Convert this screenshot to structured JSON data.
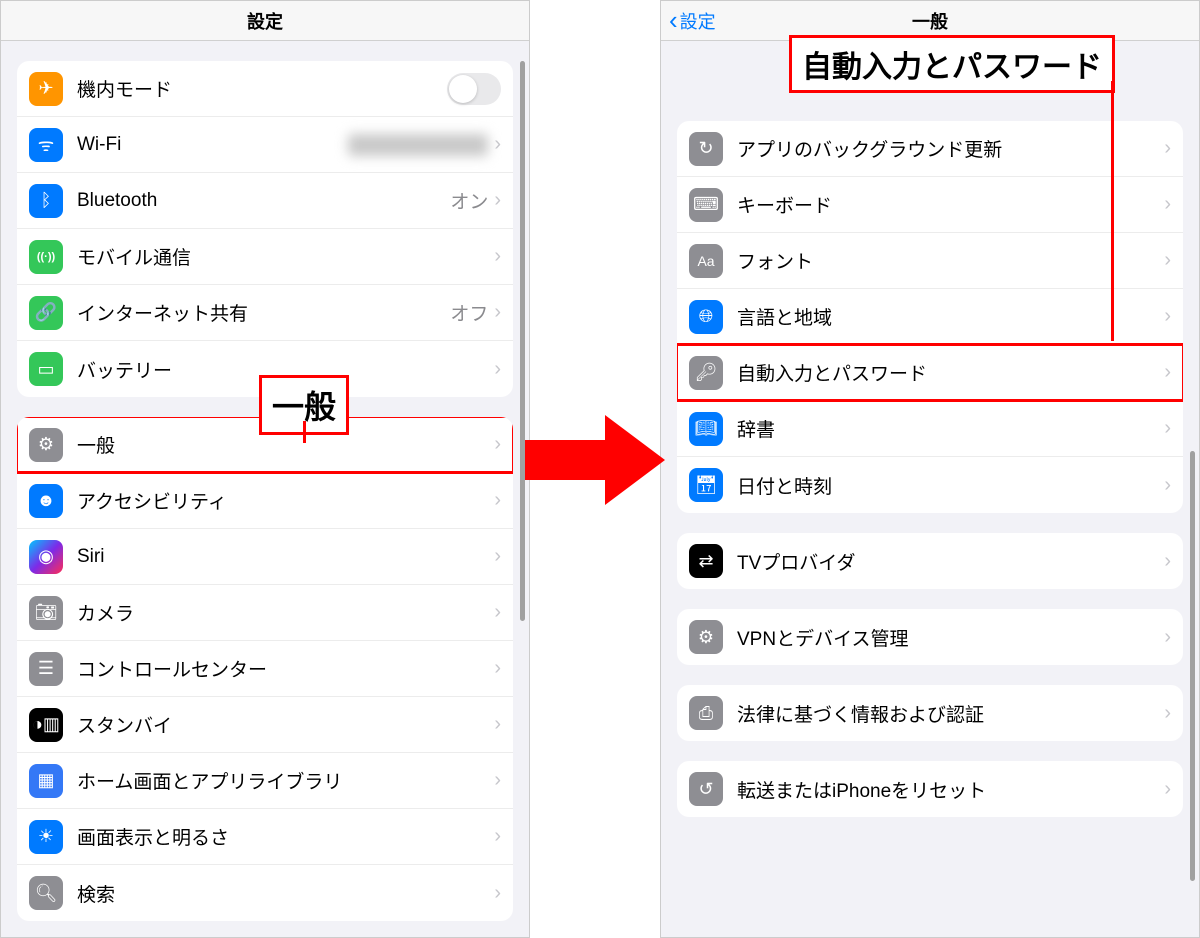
{
  "annotations": {
    "left_label": "一般",
    "right_label": "自動入力とパスワード"
  },
  "left": {
    "title": "設定",
    "items": [
      {
        "name": "airplane-mode",
        "label": "機内モード",
        "icon": "airplane-icon",
        "iconBg": "bg-orange",
        "trailing": "toggle-off"
      },
      {
        "name": "wifi",
        "label": "Wi-Fi",
        "icon": "wifi-icon",
        "iconBg": "bg-blue",
        "trailing": "redacted-chevron"
      },
      {
        "name": "bluetooth",
        "label": "Bluetooth",
        "icon": "bluetooth-icon",
        "iconBg": "bg-blue",
        "value": "オン",
        "trailing": "value-chevron"
      },
      {
        "name": "cellular",
        "label": "モバイル通信",
        "icon": "antenna-icon",
        "iconBg": "bg-green",
        "trailing": "chevron"
      },
      {
        "name": "hotspot",
        "label": "インターネット共有",
        "icon": "link-icon",
        "iconBg": "bg-green",
        "value": "オフ",
        "trailing": "value-chevron"
      },
      {
        "name": "battery",
        "label": "バッテリー",
        "icon": "battery-icon",
        "iconBg": "bg-green",
        "trailing": "chevron"
      }
    ],
    "items2": [
      {
        "name": "general",
        "label": "一般",
        "icon": "gear-icon",
        "iconBg": "bg-gray",
        "trailing": "chevron",
        "highlight": true
      },
      {
        "name": "accessibility",
        "label": "アクセシビリティ",
        "icon": "accessibility-icon",
        "iconBg": "bg-blue",
        "trailing": "chevron"
      },
      {
        "name": "siri",
        "label": "Siri",
        "icon": "siri-icon",
        "iconBg": "bg-siri",
        "trailing": "chevron"
      },
      {
        "name": "camera",
        "label": "カメラ",
        "icon": "camera-icon",
        "iconBg": "bg-gray",
        "trailing": "chevron"
      },
      {
        "name": "control-center",
        "label": "コントロールセンター",
        "icon": "sliders-icon",
        "iconBg": "bg-gray",
        "trailing": "chevron"
      },
      {
        "name": "standby",
        "label": "スタンバイ",
        "icon": "standby-icon",
        "iconBg": "bg-black",
        "trailing": "chevron"
      },
      {
        "name": "home-screen",
        "label": "ホーム画面とアプリライブラリ",
        "icon": "apps-icon",
        "iconBg": "bg-blue2",
        "trailing": "chevron"
      },
      {
        "name": "display",
        "label": "画面表示と明るさ",
        "icon": "brightness-icon",
        "iconBg": "bg-blue",
        "trailing": "chevron"
      },
      {
        "name": "search",
        "label": "検索",
        "icon": "search-icon",
        "iconBg": "bg-gray",
        "trailing": "chevron"
      }
    ]
  },
  "right": {
    "back_label": "設定",
    "title": "一般",
    "groups": [
      [
        {
          "name": "bg-refresh",
          "label": "アプリのバックグラウンド更新",
          "icon": "refresh-icon",
          "iconBg": "bg-gray"
        },
        {
          "name": "keyboard",
          "label": "キーボード",
          "icon": "keyboard-icon",
          "iconBg": "bg-gray"
        },
        {
          "name": "fonts",
          "label": "フォント",
          "icon": "font-icon",
          "iconBg": "bg-gray"
        },
        {
          "name": "language",
          "label": "言語と地域",
          "icon": "globe-icon",
          "iconBg": "bg-blue"
        },
        {
          "name": "autofill",
          "label": "自動入力とパスワード",
          "icon": "key-icon",
          "iconBg": "bg-gray",
          "highlight": true
        },
        {
          "name": "dictionary",
          "label": "辞書",
          "icon": "book-icon",
          "iconBg": "bg-blue"
        },
        {
          "name": "datetime",
          "label": "日付と時刻",
          "icon": "calendar-icon",
          "iconBg": "bg-blue"
        }
      ],
      [
        {
          "name": "tv-provider",
          "label": "TVプロバイダ",
          "icon": "tv-icon",
          "iconBg": "bg-black"
        }
      ],
      [
        {
          "name": "vpn",
          "label": "VPNとデバイス管理",
          "icon": "vpn-icon",
          "iconBg": "bg-gray"
        }
      ],
      [
        {
          "name": "legal",
          "label": "法律に基づく情報および認証",
          "icon": "cert-icon",
          "iconBg": "bg-gray"
        }
      ],
      [
        {
          "name": "reset",
          "label": "転送またはiPhoneをリセット",
          "icon": "reset-icon",
          "iconBg": "bg-gray"
        }
      ]
    ]
  },
  "icons": {
    "airplane-icon": "✈︎",
    "wifi-icon": "ᯤ",
    "bluetooth-icon": "ᛒ",
    "antenna-icon": "((·))",
    "link-icon": "🔗",
    "battery-icon": "▭",
    "gear-icon": "⚙︎",
    "accessibility-icon": "☻",
    "siri-icon": "◉",
    "camera-icon": "📷︎",
    "sliders-icon": "☰",
    "standby-icon": "◑▥",
    "apps-icon": "▦",
    "brightness-icon": "☀︎",
    "search-icon": "🔍︎",
    "refresh-icon": "↻",
    "keyboard-icon": "⌨︎",
    "font-icon": "Aa",
    "globe-icon": "🌐︎",
    "key-icon": "🔑︎",
    "book-icon": "📖︎",
    "calendar-icon": "📅︎",
    "tv-icon": "⇄",
    "vpn-icon": "⚙︎",
    "cert-icon": "⎙",
    "reset-icon": "↺"
  }
}
